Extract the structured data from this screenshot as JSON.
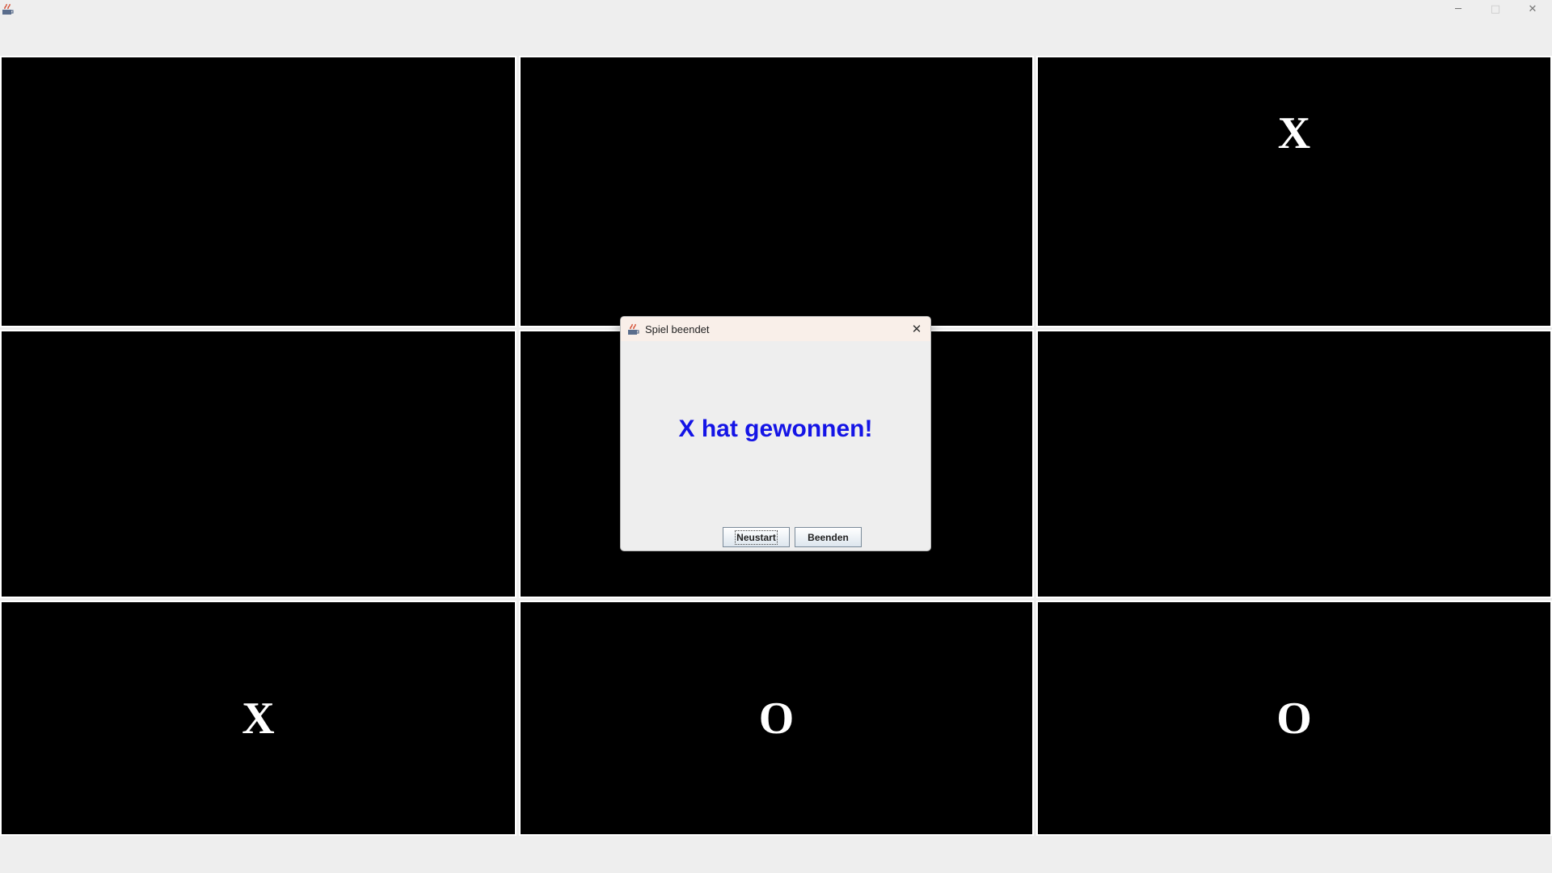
{
  "window": {
    "icon": "java-cup-icon",
    "controls": {
      "minimize_glyph": "─",
      "maximize_glyph": "□",
      "close_glyph": "✕"
    }
  },
  "board": {
    "cells": [
      {
        "mark": ""
      },
      {
        "mark": ""
      },
      {
        "mark": "X"
      },
      {
        "mark": ""
      },
      {
        "mark": ""
      },
      {
        "mark": ""
      },
      {
        "mark": "X"
      },
      {
        "mark": "O"
      },
      {
        "mark": "O"
      }
    ],
    "colors": {
      "cell_background": "#000000",
      "mark": "#ffffff",
      "grid": "#ffffff"
    }
  },
  "dialog": {
    "title": "Spiel beendet",
    "close_glyph": "✕",
    "message": "X hat gewonnen!",
    "message_color": "#1414e6",
    "buttons": {
      "restart_label": "Neustart",
      "quit_label": "Beenden"
    }
  }
}
